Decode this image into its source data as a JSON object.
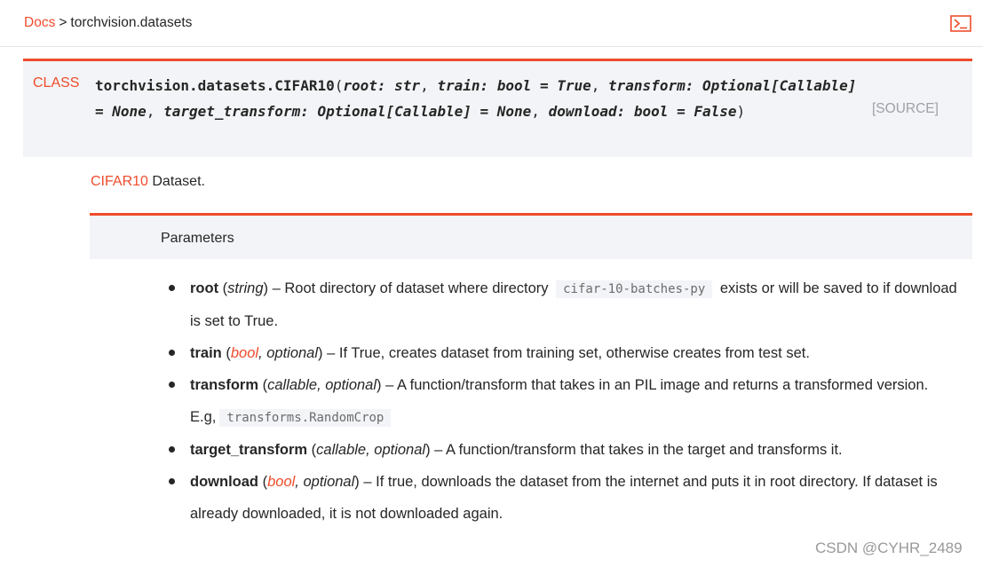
{
  "breadcrumb": {
    "docs": "Docs",
    "separator": ">",
    "current": "torchvision.datasets"
  },
  "header_icon": "terminal-icon",
  "signature": {
    "keyword": "CLASS",
    "name": "torchvision.datasets.CIFAR10",
    "open": "(",
    "close": ")",
    "params": [
      {
        "text": "root: str",
        "comma": ","
      },
      {
        "text": "train: bool = True",
        "comma": ","
      },
      {
        "text": "transform: Optional[Callable] = None",
        "comma": ","
      },
      {
        "text": "target_transform: Optional[Callable] = None",
        "comma": ","
      },
      {
        "text": "download: bool = False",
        "comma": ""
      }
    ],
    "source": "[SOURCE]"
  },
  "description": {
    "link": "CIFAR10",
    "text": " Dataset."
  },
  "parameters": {
    "title": "Parameters",
    "items": [
      {
        "name": "root",
        "open": " (",
        "type_plain": "string",
        "type_link": "",
        "type_rest": "",
        "close": ")",
        "desc1": " – Root directory of dataset where directory ",
        "code": "cifar-10-batches-py",
        "desc2": " exists or will be saved to if download is set to True."
      },
      {
        "name": "train",
        "open": " (",
        "type_plain": "",
        "type_link": "bool",
        "type_rest": ", optional",
        "close": ")",
        "desc1": " – If True, creates dataset from training set, otherwise creates from test set.",
        "code": "",
        "desc2": ""
      },
      {
        "name": "transform",
        "open": " (",
        "type_plain": "callable, optional",
        "type_link": "",
        "type_rest": "",
        "close": ")",
        "desc1": " – A function/transform that takes in an PIL image and returns a transformed version. E.g,",
        "code": "transforms.RandomCrop",
        "desc2": ""
      },
      {
        "name": "target_transform",
        "open": " (",
        "type_plain": "callable, optional",
        "type_link": "",
        "type_rest": "",
        "close": ")",
        "desc1": " – A function/transform that takes in the target and transforms it.",
        "code": "",
        "desc2": ""
      },
      {
        "name": "download",
        "open": " (",
        "type_plain": "",
        "type_link": "bool",
        "type_rest": ", optional",
        "close": ")",
        "desc1": " – If true, downloads the dataset from the internet and puts it in root directory. If dataset is already downloaded, it is not downloaded again.",
        "code": "",
        "desc2": ""
      }
    ]
  },
  "watermark": "CSDN @CYHR_2489",
  "colors": {
    "accent": "#ee4c2c",
    "box_bg": "#f3f4f7",
    "text": "#262626",
    "muted": "#9da1a8"
  }
}
